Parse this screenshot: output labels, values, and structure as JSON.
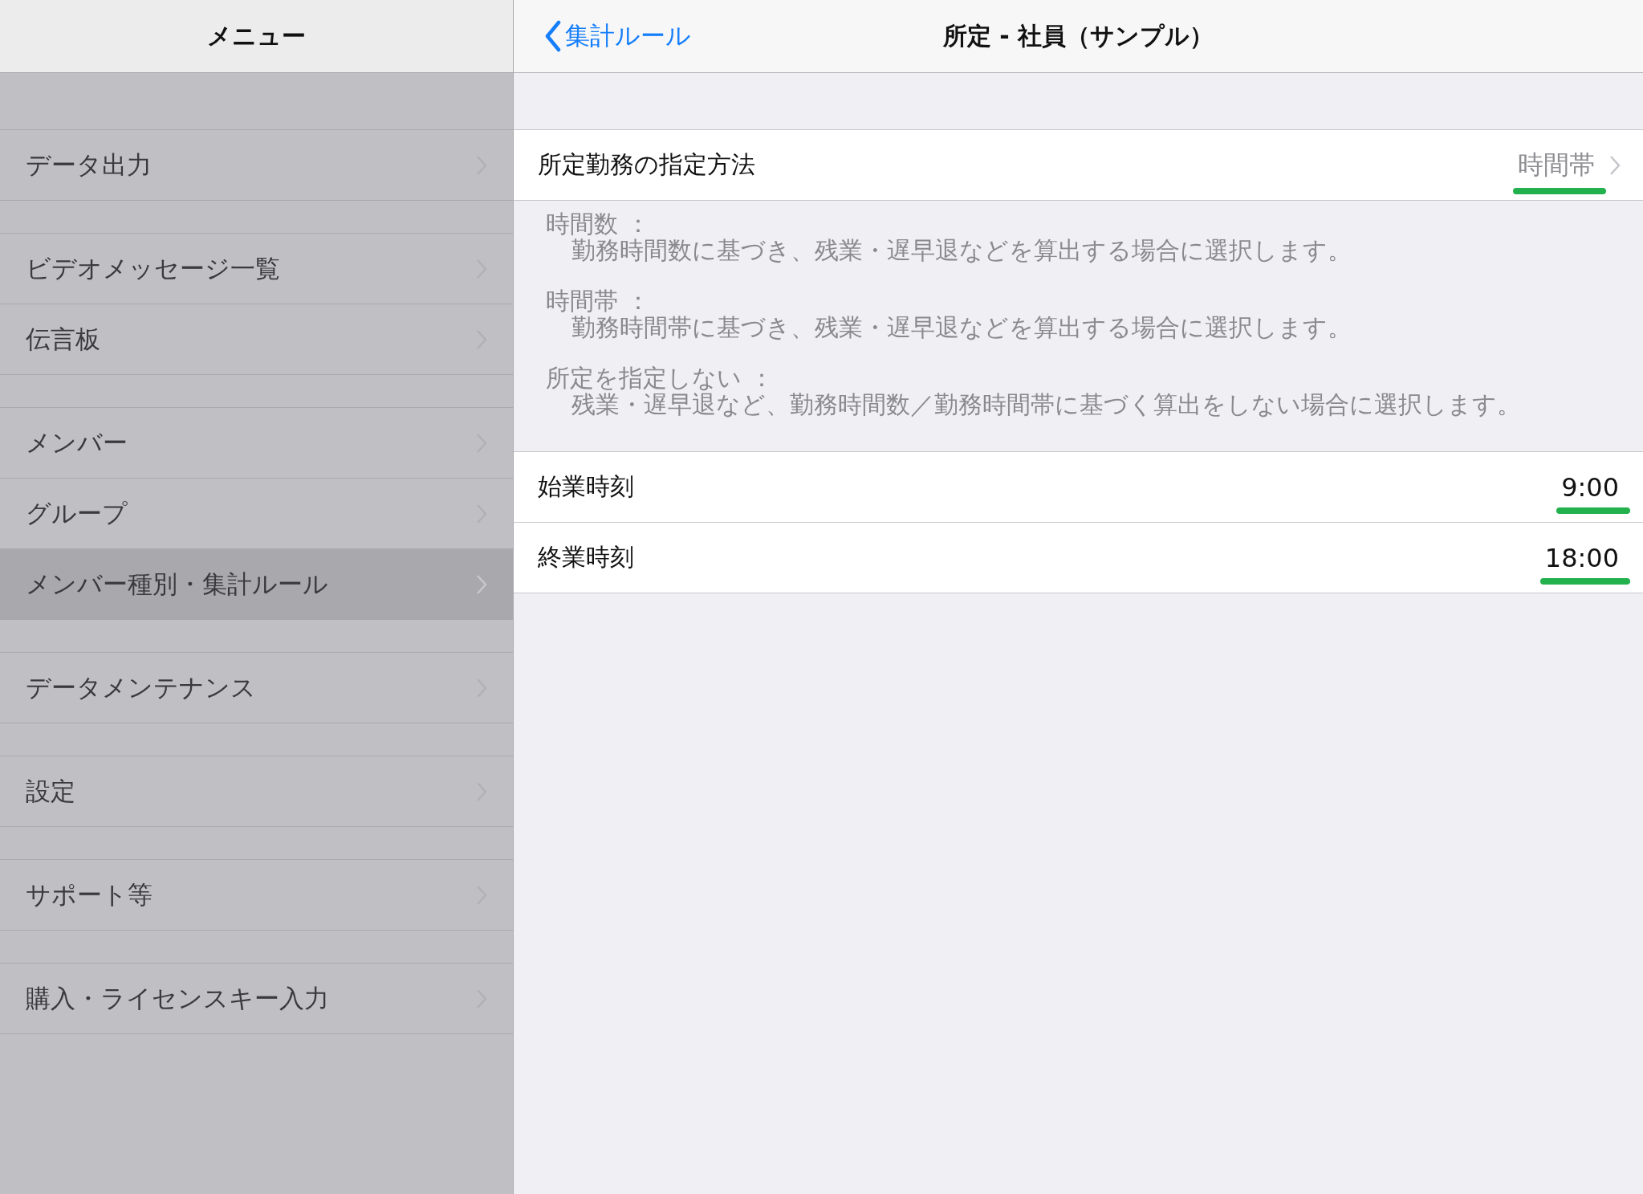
{
  "sidebar": {
    "title": "メニュー",
    "groups": [
      [
        {
          "label": "データ出力",
          "selected": false
        }
      ],
      [
        {
          "label": "ビデオメッセージ一覧",
          "selected": false
        },
        {
          "label": "伝言板",
          "selected": false
        }
      ],
      [
        {
          "label": "メンバー",
          "selected": false
        },
        {
          "label": "グループ",
          "selected": false
        },
        {
          "label": "メンバー種別・集計ルール",
          "selected": true
        }
      ],
      [
        {
          "label": "データメンテナンス",
          "selected": false
        }
      ],
      [
        {
          "label": "設定",
          "selected": false
        }
      ],
      [
        {
          "label": "サポート等",
          "selected": false
        }
      ],
      [
        {
          "label": "購入・ライセンスキー入力",
          "selected": false
        }
      ]
    ]
  },
  "navbar": {
    "back": "集計ルール",
    "title": "所定 - 社員（サンプル）"
  },
  "method_row": {
    "label": "所定勤務の指定方法",
    "value": "時間帯",
    "highlighted": true
  },
  "descriptions": [
    {
      "term": "時間数 ：",
      "text": "勤務時間数に基づき、残業・遅早退などを算出する場合に選択します。"
    },
    {
      "term": "時間帯 ：",
      "text": "勤務時間帯に基づき、残業・遅早退などを算出する場合に選択します。"
    },
    {
      "term": "所定を指定しない ：",
      "text": "残業・遅早退など、勤務時間数／勤務時間帯に基づく算出をしない場合に選択します。"
    }
  ],
  "time_rows": [
    {
      "label": "始業時刻",
      "value": "9:00",
      "highlighted": true
    },
    {
      "label": "終業時刻",
      "value": "18:00",
      "highlighted": true
    }
  ]
}
